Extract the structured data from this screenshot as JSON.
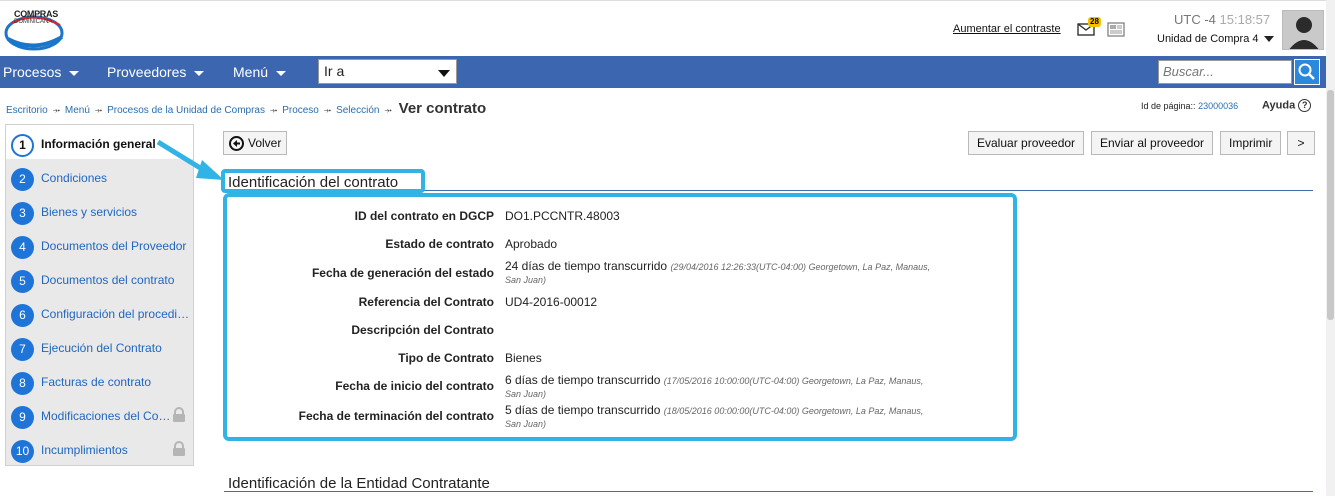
{
  "header": {
    "logo_line1": "COMPRAS",
    "logo_line2": "DOMINICANA",
    "contrast_link": "Aumentar el contraste",
    "mail_badge": "28",
    "tz_label": "UTC -4",
    "tz_time": "15:18:57",
    "unit": "Unidad de Compra 4"
  },
  "nav": {
    "items": [
      "Procesos",
      "Proveedores",
      "Menú"
    ],
    "goto_value": "Ir a",
    "search_placeholder": "Buscar..."
  },
  "breadcrumb": {
    "items": [
      "Escritorio",
      "Menú",
      "Procesos de la Unidad de Compras",
      "Proceso",
      "Selección"
    ],
    "current": "Ver contrato",
    "page_id_label": "Id de página::",
    "page_id": "23000036",
    "help": "Ayuda"
  },
  "steps": [
    {
      "num": "1",
      "label": "Información general"
    },
    {
      "num": "2",
      "label": "Condiciones"
    },
    {
      "num": "3",
      "label": "Bienes y servicios"
    },
    {
      "num": "4",
      "label": "Documentos del Proveedor"
    },
    {
      "num": "5",
      "label": "Documentos del contrato"
    },
    {
      "num": "6",
      "label": "Configuración del procedi…"
    },
    {
      "num": "7",
      "label": "Ejecución del Contrato"
    },
    {
      "num": "8",
      "label": "Facturas de contrato"
    },
    {
      "num": "9",
      "label": "Modificaciones del Co…"
    },
    {
      "num": "10",
      "label": "Incumplimientos"
    }
  ],
  "actions": {
    "back": "Volver",
    "evaluate": "Evaluar proveedor",
    "send": "Enviar al proveedor",
    "print": "Imprimir",
    "more": ">"
  },
  "contract": {
    "section_title": "Identificación del contrato",
    "fields": [
      {
        "label": "ID del contrato en DGCP",
        "value": "DO1.PCCNTR.48003",
        "note": "",
        "note2": ""
      },
      {
        "label": "Estado de contrato",
        "value": "Aprobado",
        "note": "",
        "note2": ""
      },
      {
        "label": "Fecha de generación del estado",
        "value": "24 días de tiempo transcurrido",
        "note": "(29/04/2016 12:26:33(UTC-04:00) Georgetown, La Paz, Manaus,",
        "note2": "San Juan)"
      },
      {
        "label": "Referencia del Contrato",
        "value": "UD4-2016-00012",
        "note": "",
        "note2": ""
      },
      {
        "label": "Descripción del Contrato",
        "value": "",
        "note": "",
        "note2": ""
      },
      {
        "label": "Tipo de Contrato",
        "value": "Bienes",
        "note": "",
        "note2": ""
      },
      {
        "label": "Fecha de inicio del contrato",
        "value": "6 días de tiempo transcurrido",
        "note": "(17/05/2016 10:00:00(UTC-04:00) Georgetown, La Paz, Manaus,",
        "note2": "San Juan)"
      },
      {
        "label": "Fecha de terminación del contrato",
        "value": "5 días de tiempo transcurrido",
        "note": "(18/05/2016 00:00:00(UTC-04:00) Georgetown, La Paz, Manaus,",
        "note2": "San Juan)"
      }
    ]
  },
  "section2_title": "Identificación de la Entidad Contratante",
  "colors": {
    "navbar": "#3c67b0",
    "link": "#2a6db0",
    "highlight": "#31b3e6",
    "step_circle": "#1f74d8"
  }
}
